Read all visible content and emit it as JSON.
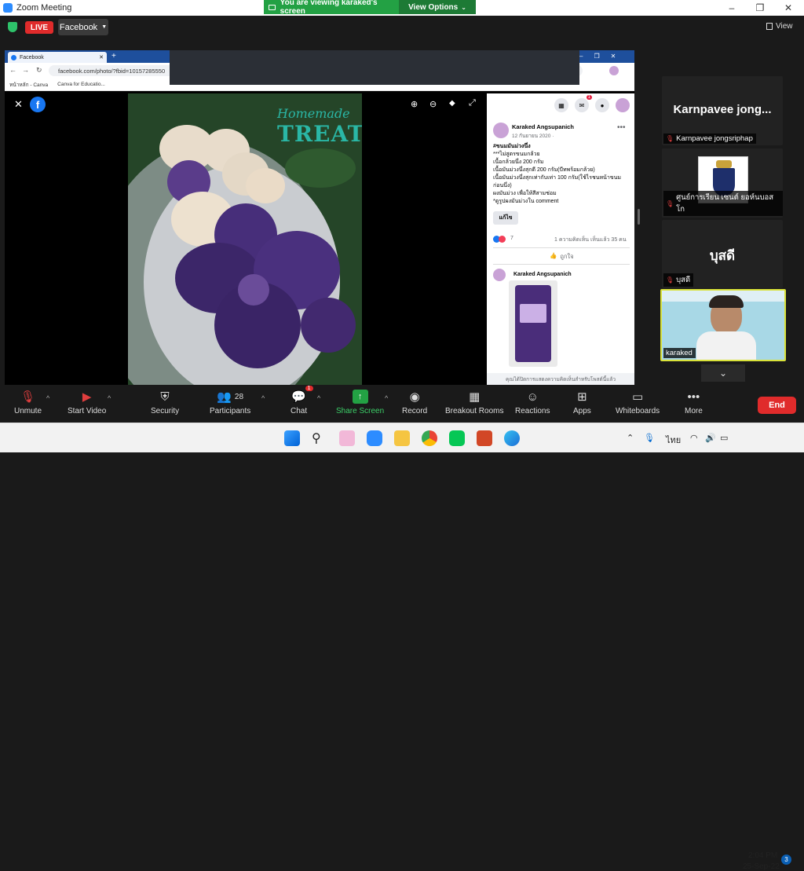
{
  "titlebar": {
    "title": "Zoom Meeting",
    "minimize": "–",
    "restore": "❐",
    "close": "✕"
  },
  "banner": {
    "text": "You are viewing karaked's screen",
    "view_options": "View Options"
  },
  "meeting": {
    "live": "LIVE",
    "platform": "Facebook",
    "view": "View"
  },
  "browser": {
    "tab_title": "Facebook",
    "url": "facebook.com/photo/?fbid=10157285550",
    "bookmarks": [
      "หน้าหลัก - Canva",
      "Canva for Educatio..."
    ]
  },
  "photo": {
    "title_line1": "Homemade",
    "title_line2": "TREATS"
  },
  "post": {
    "author": "Karaked Angsupanich",
    "date": "12 กันยายน 2020 · ",
    "lines": [
      "#ขนมมันม่วงนึ่ง",
      "***ไม่สูตรขนมกล้วย",
      "เนื้อกล้วยนึ่ง 200 กรัม",
      "เนื้อมันม่วงนึ่งสุกดี 200 กรัม(บีทพร้อมกล้วย)",
      "เนื้อมันม่วงนึ่งสุกเท่ากับเท่า 100 กรัม(ใช้ไรชนหน้าขนมก่อนนึ่ง)",
      "ผงมันม่วง เพื่อให้สีสามช่อม",
      "*ดูรูปผงมันม่วงใน comment"
    ],
    "edit_button": "แก้ไข",
    "reaction_count": "7",
    "stats": "1 ความคิดเห็น  เห็นแล้ว 35 คน",
    "like": "ถูกใจ",
    "commenter": "Karaked Angsupanich",
    "footer": "คุณได้ปิดการแสดงความคิดเห็นสำหรับโพสต์นี้แล้ว",
    "notification_count": "1"
  },
  "participants": [
    {
      "big": "Karnpavee  jong...",
      "label": "Karnpavee jongsriphap"
    },
    {
      "big": "",
      "label": "ศูนย์การเรียน เซนต์ ยอห์นบอสโก"
    },
    {
      "big": "บุสดี",
      "label": "บุสดี"
    },
    {
      "big": "",
      "label": "karaked"
    }
  ],
  "toolbar": {
    "unmute": "Unmute",
    "start_video": "Start Video",
    "security": "Security",
    "participants": "Participants",
    "participants_count": "28",
    "chat": "Chat",
    "chat_badge": "1",
    "share_screen": "Share Screen",
    "record": "Record",
    "breakout": "Breakout Rooms",
    "reactions": "Reactions",
    "apps": "Apps",
    "whiteboards": "Whiteboards",
    "more": "More",
    "end": "End"
  },
  "taskbar": {
    "lang": "ไทย",
    "time": "2:04 PM",
    "date": "25-Sep-22",
    "notif": "3"
  },
  "colors": {
    "zoom_green": "#23a144",
    "end_red": "#e02b2b",
    "fb_blue": "#1877f2",
    "accent_teal": "#2ab7a6"
  }
}
